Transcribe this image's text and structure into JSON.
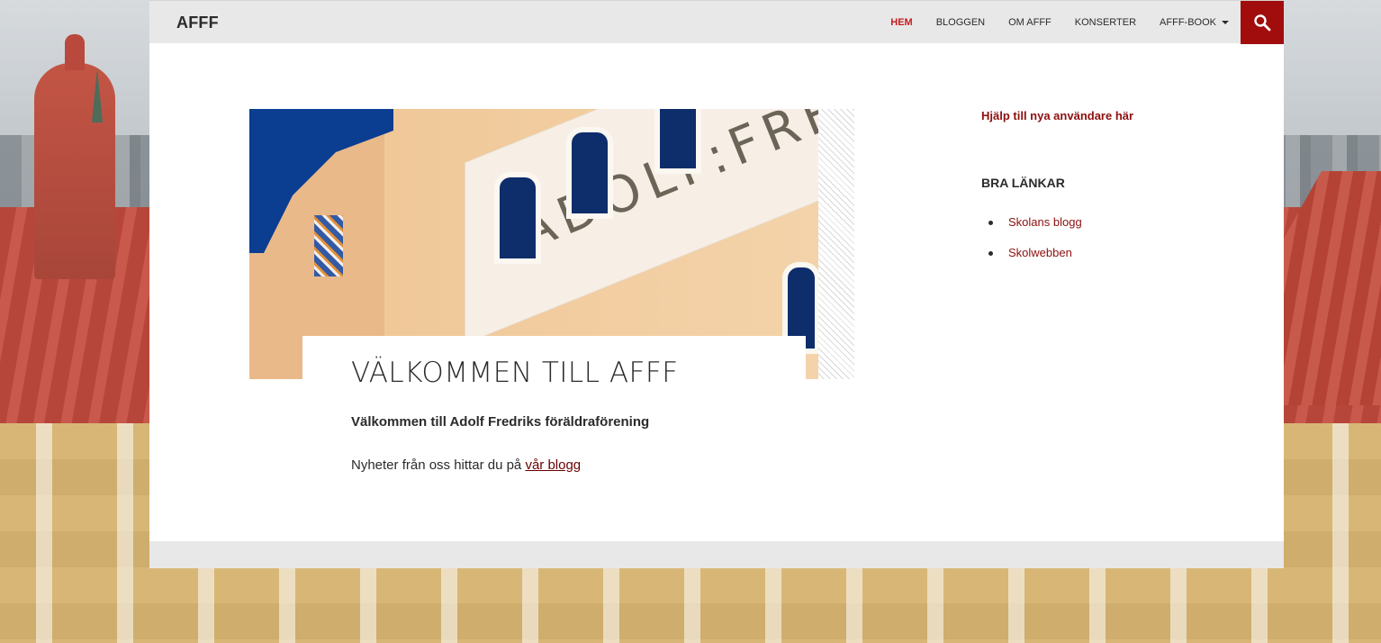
{
  "header": {
    "site_title": "AFFF",
    "nav": [
      {
        "label": "HEM",
        "active": true
      },
      {
        "label": "BLOGGEN",
        "active": false
      },
      {
        "label": "OM AFFF",
        "active": false
      },
      {
        "label": "KONSERTER",
        "active": false
      },
      {
        "label": "AFFF-BOOK",
        "active": false,
        "dropdown": true
      }
    ],
    "search_icon": "search-icon"
  },
  "featured_image": {
    "text": "ADOLF:FREDRI"
  },
  "entry": {
    "title": "VÄLKOMMEN TILL AFFF",
    "lead": "Välkommen till Adolf Fredriks föräldraförening",
    "text_prefix": "Nyheter från oss hittar du på ",
    "link_text": "vår blogg"
  },
  "sidebar": {
    "help_link": "Hjälp till nya användare här",
    "widget_title": "BRA LÄNKAR",
    "links": [
      "Skolans blogg",
      "Skolwebben"
    ]
  },
  "colors": {
    "accent": "#a10c0c",
    "link": "#8e0f0f",
    "header_bg": "#e8e8e8"
  }
}
